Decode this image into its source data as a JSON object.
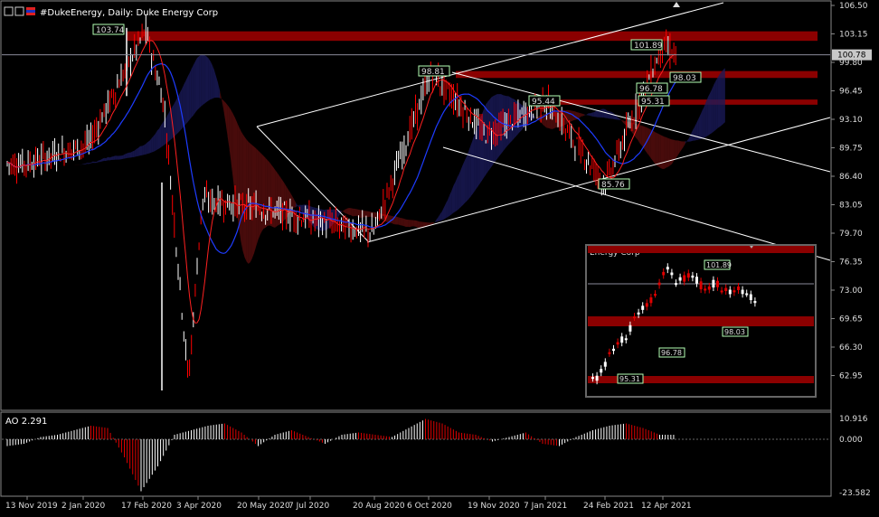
{
  "window": {
    "title": "#DukeEnergy, Daily:  Duke Energy Corp",
    "icons": [
      "chart-window-icon",
      "restore-icon",
      "flag-icon"
    ]
  },
  "colors": {
    "background": "#000000",
    "bull": "#ffffff",
    "bear": "#ff0000",
    "zone": "#8b0000",
    "kijun": "#1e3cff",
    "tenkan": "#ff2020",
    "cloud": "#1a1a5a",
    "cloud_bear": "#5a0e0e",
    "label_box": "#b4ffb4"
  },
  "chart_data": [
    {
      "type": "line",
      "title": "#DukeEnergy, Daily:  Duke Energy Corp",
      "ylim": [
        76.35,
        106.5
      ],
      "y_ticks": [
        "106.50",
        "103.15",
        "99.80",
        "96.45",
        "93.10",
        "89.75",
        "86.40",
        "83.05",
        "79.70",
        "76.35",
        "73.00",
        "69.65",
        "66.30",
        "62.95"
      ],
      "x_ticks": [
        "13 Nov 2019",
        "2 Jan 2020",
        "17 Feb 2020",
        "3 Apr 2020",
        "20 May 2020",
        "7 Jul 2020",
        "20 Aug 2020",
        "6 Oct 2020",
        "19 Nov 2020",
        "7 Jan 2021",
        "24 Feb 2021",
        "12 Apr 2021"
      ],
      "current_price": "100.78",
      "series": [
        {
          "x": [
            "13 Nov 2019",
            "2 Jan 2020",
            "17 Feb 2020",
            "3 Mar 2020",
            "23 Mar 2020",
            "3 Apr 2020",
            "20 May 2020",
            "7 Jul 2020",
            "20 Aug 2020",
            "6 Oct 2020",
            "19 Nov 2020",
            "7 Jan 2021",
            "24 Feb 2021",
            "12 Apr 2021",
            "22 Apr 2021"
          ],
          "values": [
            88.2,
            90.5,
            103.7,
            95.0,
            62.9,
            84.0,
            83.0,
            81.5,
            80.2,
            98.8,
            91.5,
            95.4,
            85.8,
            101.9,
            100.8
          ]
        }
      ],
      "annotations": [
        {
          "label": "103.74",
          "x": "17 Feb 2020",
          "y": 103.74
        },
        {
          "label": "98.81",
          "x": "6 Oct 2020",
          "y": 98.81
        },
        {
          "label": "95.44",
          "x": "7 Jan 2021",
          "y": 95.44
        },
        {
          "label": "85.76",
          "x": "24 Feb 2021",
          "y": 85.76
        },
        {
          "label": "101.89",
          "x": "12 Apr 2021",
          "y": 101.89
        },
        {
          "label": "98.03",
          "x": "12 Apr 2021",
          "y": 98.03
        },
        {
          "label": "96.78",
          "x": "12 Apr 2021",
          "y": 96.78
        },
        {
          "label": "95.31",
          "x": "12 Apr 2021",
          "y": 95.31
        }
      ],
      "zones": [
        [
          102.4,
          103.5
        ],
        [
          98.1,
          98.9
        ],
        [
          95.0,
          95.6
        ]
      ]
    },
    {
      "type": "bar",
      "title": "AO 2.291",
      "ylim": [
        -23.582,
        10.916
      ],
      "y_ticks": [
        "10.916",
        "0.000",
        "-23.582"
      ],
      "values": [
        -3,
        -2,
        1,
        2,
        4,
        6,
        5,
        -8,
        -23,
        -12,
        2,
        4,
        6,
        7,
        3,
        -3,
        2,
        4,
        1,
        -2,
        2,
        3,
        2,
        1,
        5,
        9,
        7,
        3,
        2,
        -1,
        1,
        3,
        -2,
        -3,
        1,
        4,
        6,
        7,
        5,
        2
      ]
    }
  ],
  "inset": {
    "title": "Energy Corp",
    "labels": [
      "101.89",
      "98.03",
      "96.78",
      "95.31"
    ]
  }
}
